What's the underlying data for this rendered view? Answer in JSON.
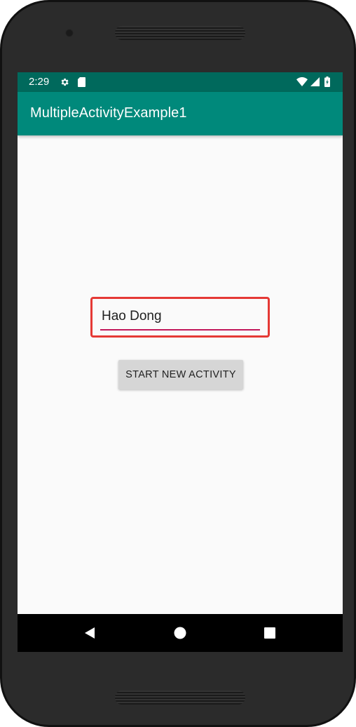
{
  "status_bar": {
    "time": "2:29",
    "icons": [
      "gear-icon",
      "sd-card-icon",
      "wifi-icon",
      "signal-icon",
      "battery-icon"
    ]
  },
  "app_bar": {
    "title": "MultipleActivityExample1"
  },
  "main": {
    "name_input": {
      "value": "Hao Dong"
    },
    "start_button": {
      "label": "START NEW ACTIVITY"
    }
  },
  "nav_bar": {
    "icons": [
      "back-icon",
      "home-icon",
      "recents-icon"
    ]
  },
  "colors": {
    "status_bar": "#00695c",
    "app_bar": "#00897b",
    "input_underline": "#c2185b",
    "highlight_box": "#e53935"
  }
}
